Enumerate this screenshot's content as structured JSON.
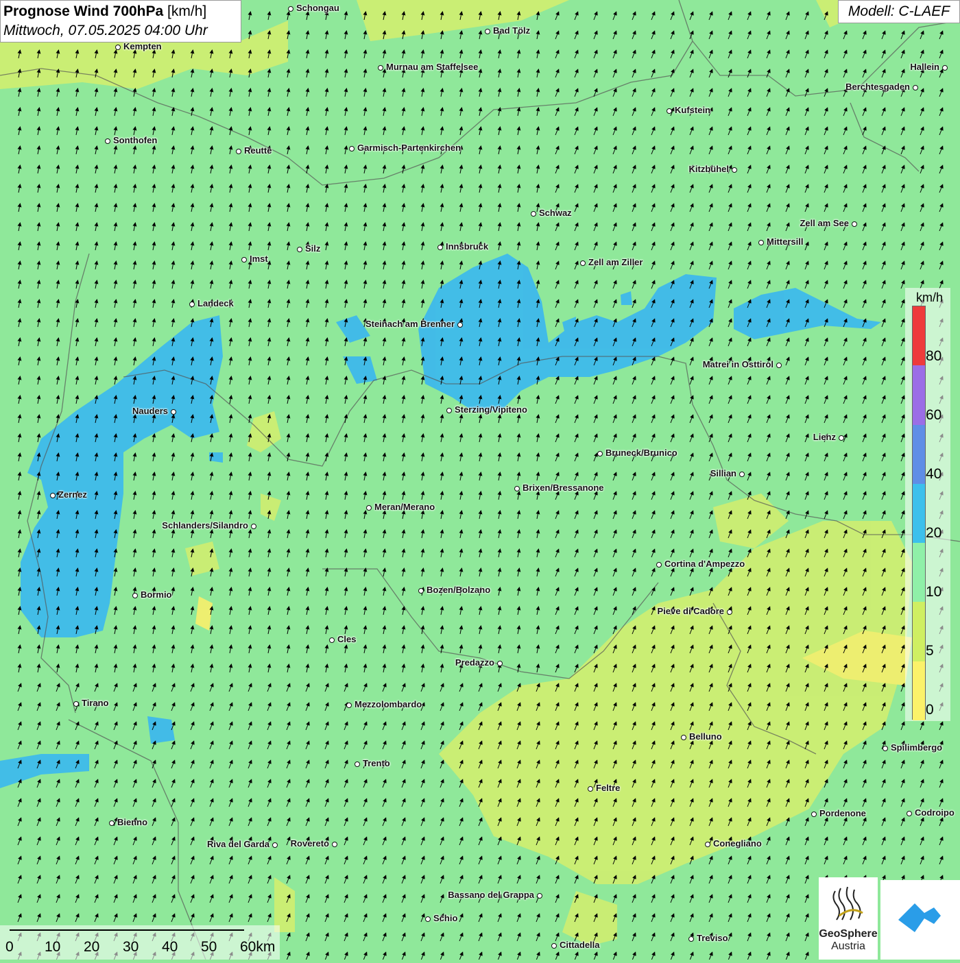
{
  "title": {
    "main": "Prognose Wind 700hPa",
    "unit": "[km/h]",
    "date": "Mittwoch, 07.05.2025 04:00 Uhr"
  },
  "model": "Modell: C-LAEF",
  "cities": [
    {
      "name": "Schongau"
    },
    {
      "name": "Bad Tölz"
    },
    {
      "name": "Kempten"
    },
    {
      "name": "Murnau am Staffelsee"
    },
    {
      "name": "Hallein"
    },
    {
      "name": "Berchtesgaden"
    },
    {
      "name": "Kufstein"
    },
    {
      "name": "Sonthofen"
    },
    {
      "name": "Reutte"
    },
    {
      "name": "Garmisch-Partenkirchen"
    },
    {
      "name": "Kitzbühel"
    },
    {
      "name": "Schwaz"
    },
    {
      "name": "Zell am See"
    },
    {
      "name": "Mittersill"
    },
    {
      "name": "Innsbruck"
    },
    {
      "name": "Silz"
    },
    {
      "name": "Imst"
    },
    {
      "name": "Zell am Ziller"
    },
    {
      "name": "Landeck"
    },
    {
      "name": "Steinach am Brenner"
    },
    {
      "name": "Matrei in Osttirol"
    },
    {
      "name": "Nauders"
    },
    {
      "name": "Sterzing/Vipiteno"
    },
    {
      "name": "Lienz"
    },
    {
      "name": "Bruneck/Brunico"
    },
    {
      "name": "Sillian"
    },
    {
      "name": "Zernez"
    },
    {
      "name": "Brixen/Bressanone"
    },
    {
      "name": "Meran/Merano"
    },
    {
      "name": "Schlanders/Silandro"
    },
    {
      "name": "Cortina d'Ampezzo"
    },
    {
      "name": "Bozen/Bolzano"
    },
    {
      "name": "Bormio"
    },
    {
      "name": "Pieve di Cadore"
    },
    {
      "name": "Cles"
    },
    {
      "name": "Predazzo"
    },
    {
      "name": "Tirano"
    },
    {
      "name": "Mezzolombardo"
    },
    {
      "name": "Belluno"
    },
    {
      "name": "Spilimbergo"
    },
    {
      "name": "Trento"
    },
    {
      "name": "Feltre"
    },
    {
      "name": "Pordenone"
    },
    {
      "name": "Codroipo"
    },
    {
      "name": "Bienno"
    },
    {
      "name": "Riva del Garda"
    },
    {
      "name": "Rovereto"
    },
    {
      "name": "Conegliano"
    },
    {
      "name": "Bassano del Grappa"
    },
    {
      "name": "Schio"
    },
    {
      "name": "Treviso"
    },
    {
      "name": "Cittadella"
    }
  ],
  "legend": {
    "unit": "km/h",
    "labels": [
      "80",
      "60",
      "40",
      "20",
      "10",
      "5",
      "0"
    ],
    "colors": [
      "#ee3b3b",
      "#9b6ee6",
      "#5f8ee6",
      "#3cc0ec",
      "#8ff0a8",
      "#cfef62",
      "#fbf26a"
    ]
  },
  "scale": {
    "labels": [
      "0",
      "10",
      "20",
      "30",
      "40",
      "50",
      "60km"
    ]
  },
  "logo": {
    "name1": "GeoSphere",
    "name2": "Austria"
  },
  "colors": {
    "base": "#8fe89a",
    "blue": "#3cb8ee",
    "yellow": "#d6ee70"
  }
}
